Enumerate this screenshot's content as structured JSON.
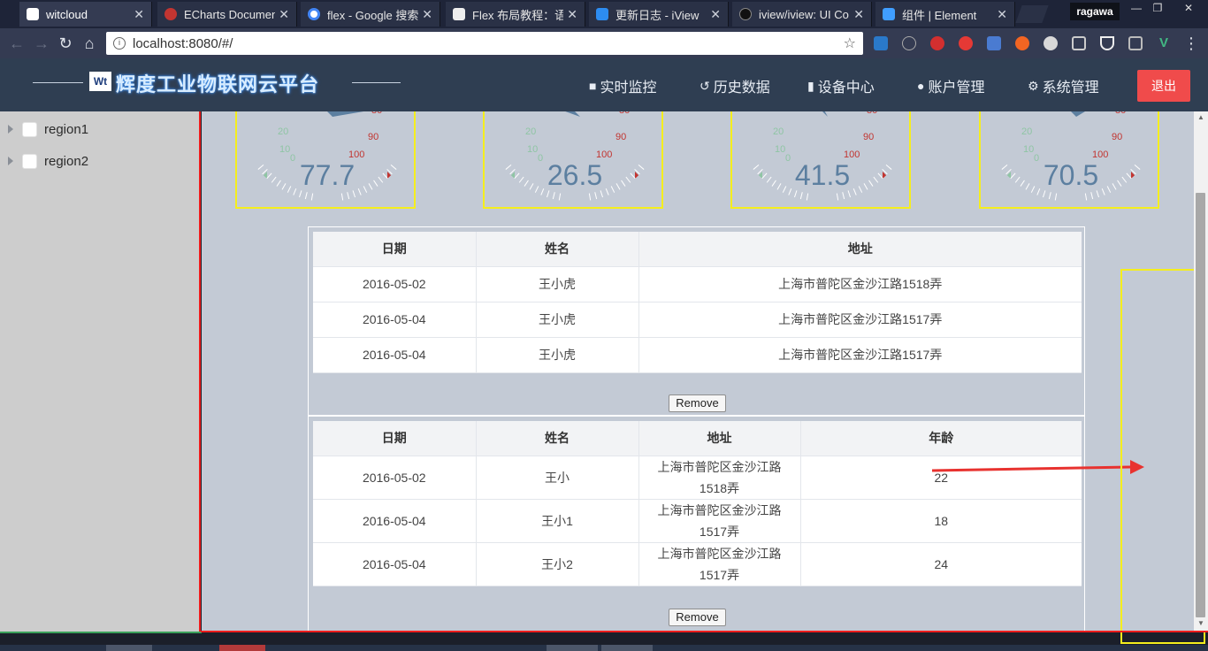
{
  "browser": {
    "tabs": [
      {
        "title": "witcloud",
        "active": true,
        "favicon_color": "#ffffff"
      },
      {
        "title": "ECharts Documen",
        "favicon_color": "#c23531"
      },
      {
        "title": "flex - Google 搜索",
        "favicon_color": "#4285f4"
      },
      {
        "title": "Flex 布局教程：语",
        "favicon_color": "#eeeeee"
      },
      {
        "title": "更新日志 - iView",
        "favicon_color": "#2d8cf0"
      },
      {
        "title": "iview/iview: UI Co",
        "favicon_color": "#24292e"
      },
      {
        "title": "组件 | Element",
        "favicon_color": "#409eff"
      }
    ],
    "user": "ragawa",
    "url": "localhost:8080/#/"
  },
  "header": {
    "logo_text": "Wt",
    "title": "辉度工业物联网云平台",
    "menu": [
      {
        "label": "实时监控",
        "icon": "video-camera-icon"
      },
      {
        "label": "历史数据",
        "icon": "history-icon"
      },
      {
        "label": "设备中心",
        "icon": "device-icon"
      },
      {
        "label": "账户管理",
        "icon": "users-icon"
      },
      {
        "label": "系统管理",
        "icon": "gear-icon"
      }
    ],
    "logout_label": "退出",
    "logout_color": "#f04b4b"
  },
  "sidebar": {
    "tree": [
      {
        "label": "region1"
      },
      {
        "label": "region2"
      }
    ]
  },
  "gauges": [
    {
      "value": "77.7",
      "percent": 77.7
    },
    {
      "value": "26.5",
      "percent": 26.5
    },
    {
      "value": "41.5",
      "percent": 41.5
    },
    {
      "value": "70.5",
      "percent": 70.5
    }
  ],
  "gauge_ticks": {
    "left": [
      "20",
      "10",
      "0"
    ],
    "right": [
      "80",
      "90",
      "100"
    ]
  },
  "table1": {
    "headers": [
      "日期",
      "姓名",
      "地址"
    ],
    "rows": [
      [
        "2016-05-02",
        "王小虎",
        "上海市普陀区金沙江路1518弄"
      ],
      [
        "2016-05-04",
        "王小虎",
        "上海市普陀区金沙江路1517弄"
      ],
      [
        "2016-05-04",
        "王小虎",
        "上海市普陀区金沙江路1517弄"
      ]
    ],
    "remove_label": "Remove"
  },
  "table2": {
    "headers": [
      "日期",
      "姓名",
      "地址",
      "年龄"
    ],
    "rows": [
      [
        "2016-05-02",
        "王小",
        "上海市普陀区金沙江路1518弄",
        "22"
      ],
      [
        "2016-05-04",
        "王小1",
        "上海市普陀区金沙江路1517弄",
        "18"
      ],
      [
        "2016-05-04",
        "王小2",
        "上海市普陀区金沙江路1517弄",
        "24"
      ]
    ],
    "remove_label": "Remove"
  }
}
